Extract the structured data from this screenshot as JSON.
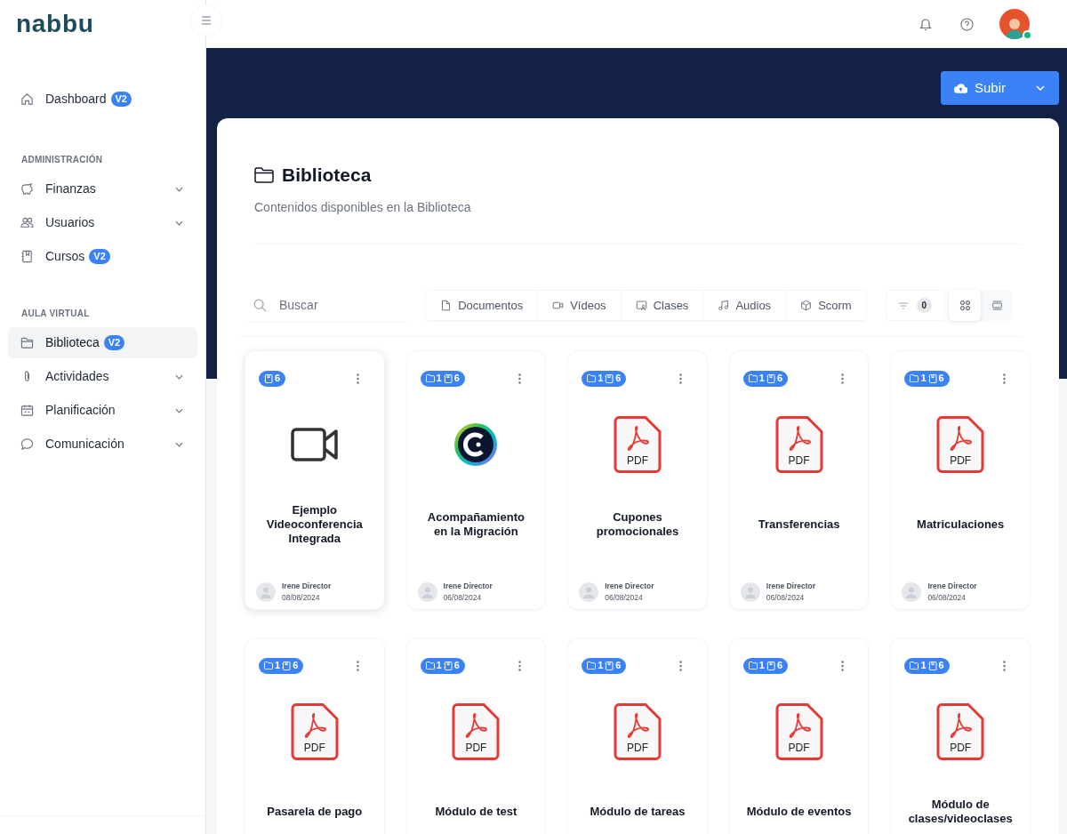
{
  "logo": "nabbu",
  "sidebar": {
    "sections": [
      {
        "items": [
          {
            "label": "Dashboard",
            "badge": "V2",
            "expandable": false,
            "selected": false
          }
        ]
      },
      {
        "title": "ADMINISTRACIÓN",
        "items": [
          {
            "label": "Finanzas",
            "expandable": true,
            "selected": false
          },
          {
            "label": "Usuarios",
            "expandable": true,
            "selected": false
          },
          {
            "label": "Cursos",
            "badge": "V2",
            "expandable": false,
            "selected": false
          }
        ]
      },
      {
        "title": "AULA VIRTUAL",
        "items": [
          {
            "label": "Biblioteca",
            "badge": "V2",
            "expandable": false,
            "selected": true
          },
          {
            "label": "Actividades",
            "expandable": true,
            "selected": false
          },
          {
            "label": "Planificación",
            "expandable": true,
            "selected": false
          },
          {
            "label": "Comunicación",
            "expandable": true,
            "selected": false
          }
        ]
      }
    ]
  },
  "header": {
    "user_online": true
  },
  "upload_button": {
    "label": "Subir"
  },
  "page": {
    "title": "Biblioteca",
    "subtitle": "Contenidos disponibles en la Biblioteca"
  },
  "search": {
    "placeholder": "Buscar"
  },
  "type_tabs": [
    {
      "label": "Documentos",
      "selected": false
    },
    {
      "label": "Vídeos",
      "selected": false
    },
    {
      "label": "Clases",
      "selected": false
    },
    {
      "label": "Audios",
      "selected": false
    },
    {
      "label": "Scorm",
      "selected": false
    }
  ],
  "filter": {
    "count": "0"
  },
  "view_modes": [
    {
      "selected": true
    },
    {
      "selected": false
    }
  ],
  "cards": [
    {
      "kind": "video",
      "books": "6",
      "title": "Ejemplo Videoconferencia Integrada",
      "author": "Irene Director",
      "date": "08/08/2024"
    },
    {
      "kind": "app",
      "folders": "1",
      "books": "6",
      "title": "Acompañamiento en la Migración",
      "author": "Irene Director",
      "date": "06/08/2024"
    },
    {
      "kind": "pdf",
      "file_label": "PDF",
      "folders": "1",
      "books": "6",
      "title": "Cupones promocionales",
      "author": "Irene Director",
      "date": "06/08/2024"
    },
    {
      "kind": "pdf",
      "file_label": "PDF",
      "folders": "1",
      "books": "6",
      "title": "Transferencias",
      "author": "Irene Director",
      "date": "06/08/2024"
    },
    {
      "kind": "pdf",
      "file_label": "PDF",
      "folders": "1",
      "books": "6",
      "title": "Matriculaciones",
      "author": "Irene Director",
      "date": "06/08/2024"
    },
    {
      "kind": "pdf",
      "file_label": "PDF",
      "folders": "1",
      "books": "6",
      "title": "Pasarela de pago"
    },
    {
      "kind": "pdf",
      "file_label": "PDF",
      "folders": "1",
      "books": "6",
      "title": "Módulo de test"
    },
    {
      "kind": "pdf",
      "file_label": "PDF",
      "folders": "1",
      "books": "6",
      "title": "Módulo de tareas"
    },
    {
      "kind": "pdf",
      "file_label": "PDF",
      "folders": "1",
      "books": "6",
      "title": "Módulo de eventos"
    },
    {
      "kind": "pdf",
      "file_label": "PDF",
      "folders": "1",
      "books": "6",
      "title": "Módulo de clases/videoclases"
    }
  ]
}
